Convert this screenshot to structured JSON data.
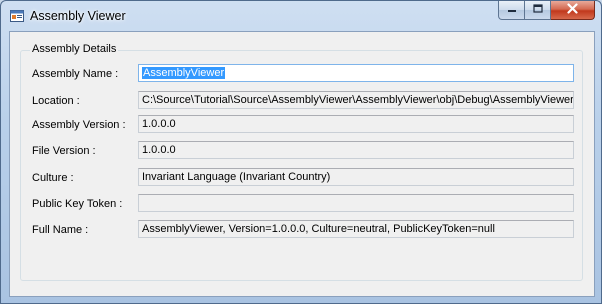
{
  "window": {
    "title": "Assembly Viewer"
  },
  "group": {
    "title": "Assembly Details",
    "fields": [
      {
        "label": "Assembly Name :",
        "value": "AssemblyViewer"
      },
      {
        "label": "Location :",
        "value": "C:\\Source\\Tutorial\\Source\\AssemblyViewer\\AssemblyViewer\\obj\\Debug\\AssemblyViewer.exe"
      },
      {
        "label": "Assembly Version :",
        "value": "1.0.0.0"
      },
      {
        "label": "File Version :",
        "value": "1.0.0.0"
      },
      {
        "label": "Culture :",
        "value": "Invariant Language (Invariant Country)"
      },
      {
        "label": "Public Key Token :",
        "value": ""
      },
      {
        "label": "Full Name :",
        "value": "AssemblyViewer, Version=1.0.0.0, Culture=neutral, PublicKeyToken=null"
      }
    ]
  },
  "icons": {
    "app": "app-window-icon",
    "minimize": "minimize-icon",
    "maximize": "maximize-icon",
    "close": "close-icon"
  },
  "colors": {
    "selection": "#3399ff",
    "close_button": "#c1391c",
    "titlebar": "#b9d0ea"
  }
}
